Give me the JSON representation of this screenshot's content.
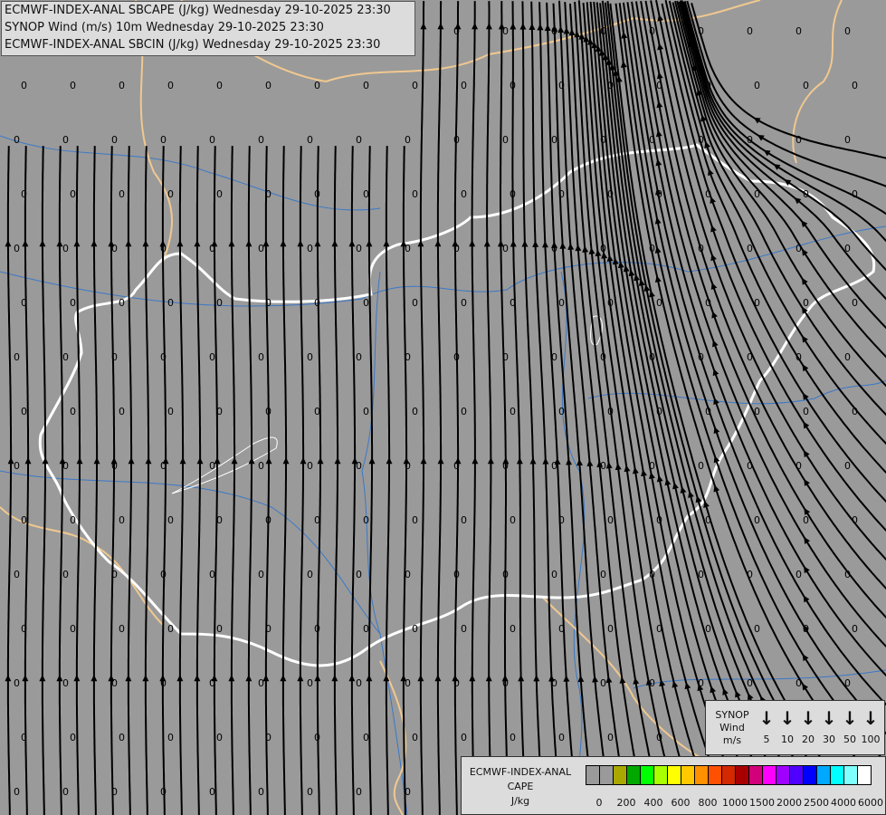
{
  "titles": [
    "ECMWF-INDEX-ANAL SBCAPE (J/kg) Wednesday 29-10-2025 23:30",
    "SYNOP Wind (m/s) 10m Wednesday 29-10-2025 23:30",
    "ECMWF-INDEX-ANAL SBCIN (J/kg) Wednesday 29-10-2025 23:30"
  ],
  "cin_value": "0",
  "wind_legend": {
    "label_lines": [
      "SYNOP",
      "Wind",
      "m/s"
    ],
    "speeds": [
      "5",
      "10",
      "20",
      "30",
      "50",
      "100"
    ],
    "arrow_icon": "↓"
  },
  "cape_legend": {
    "label_lines": [
      "ECMWF-INDEX-ANAL",
      "CAPE",
      "J/kg"
    ],
    "colors": [
      "#9a9a9a",
      "#9a9a9a",
      "#a8a800",
      "#00a800",
      "#00ff00",
      "#a8ff00",
      "#ffff00",
      "#ffc800",
      "#ff9000",
      "#ff5000",
      "#d42800",
      "#a80000",
      "#d2007a",
      "#ff00ff",
      "#a000ff",
      "#5000ff",
      "#0000ff",
      "#00a8ff",
      "#00ffff",
      "#80ffff",
      "#ffffff"
    ],
    "ticks": [
      "0",
      "200",
      "400",
      "600",
      "800",
      "1000",
      "1500",
      "2000",
      "2500",
      "4000",
      "6000"
    ]
  },
  "colors": {
    "background": "#9a9a9a",
    "hungary_border": "#ffffff",
    "country_border": "#f0c890",
    "rivers": "#3a78c8",
    "streamlines": "#000000"
  }
}
